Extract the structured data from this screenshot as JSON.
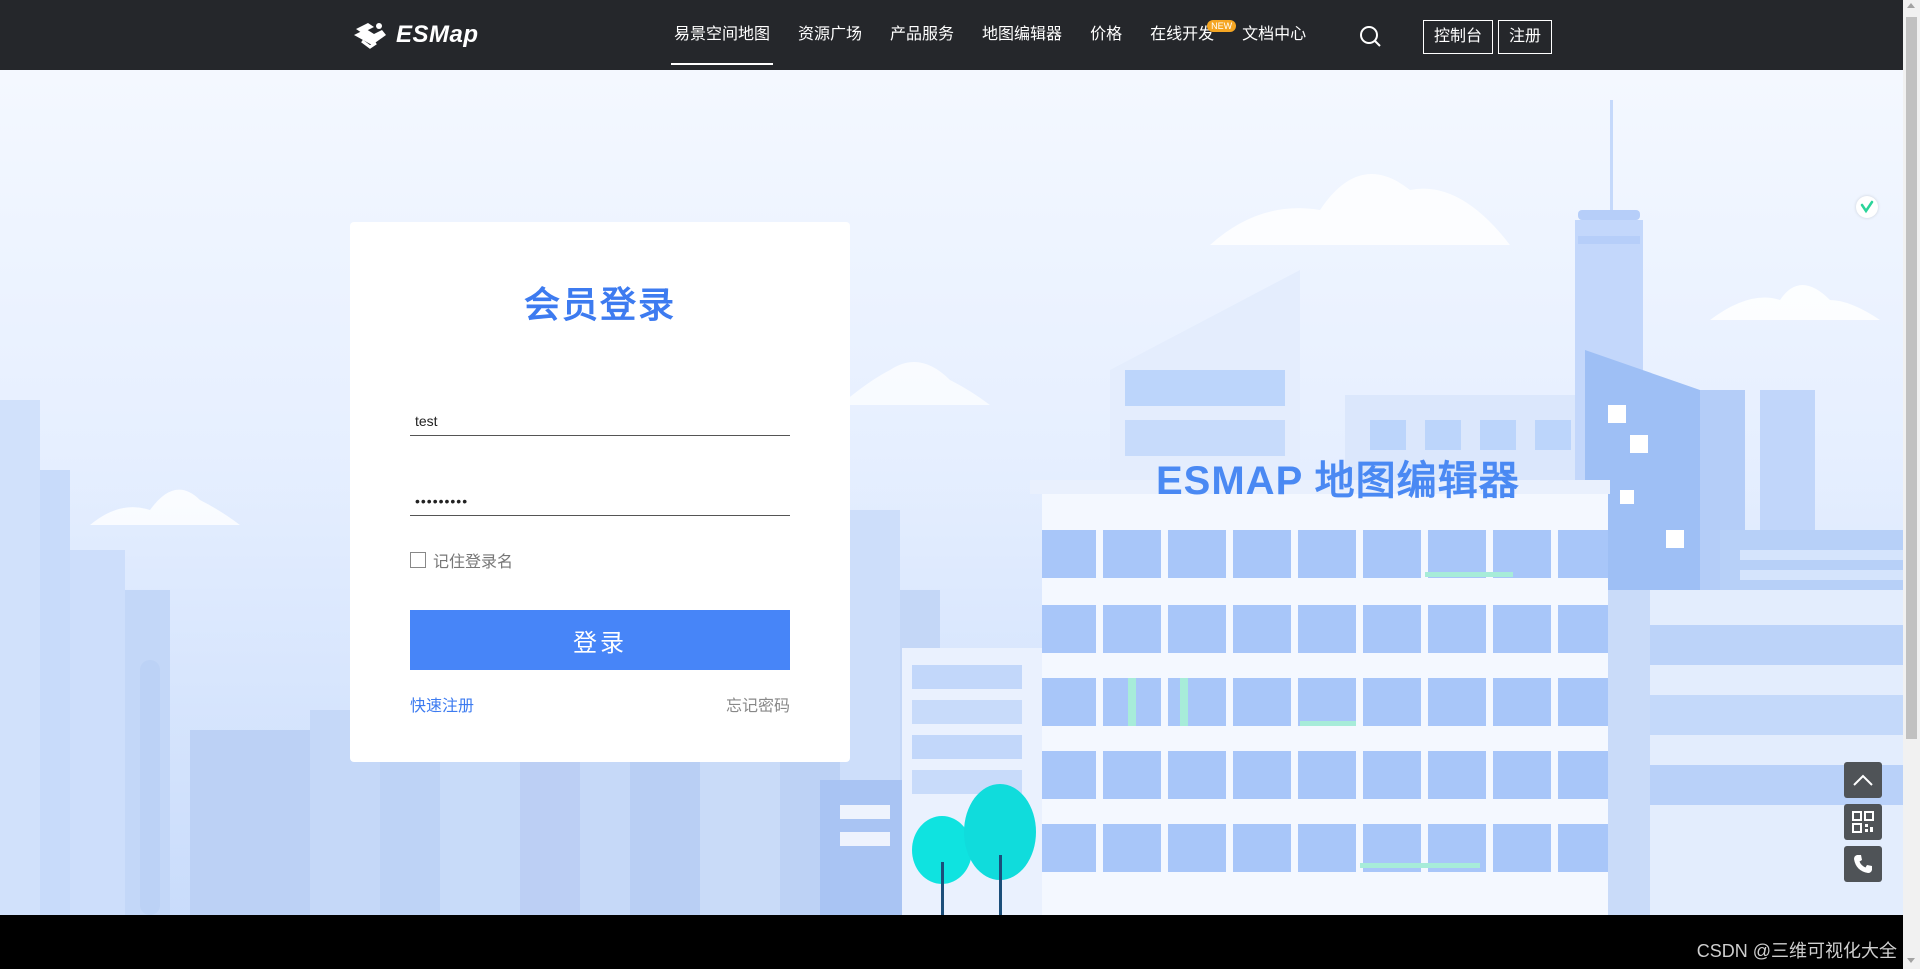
{
  "brand": {
    "name": "ESMap"
  },
  "nav": {
    "items": [
      {
        "label": "易景空间地图",
        "active": true
      },
      {
        "label": "资源广场"
      },
      {
        "label": "产品服务"
      },
      {
        "label": "地图编辑器"
      },
      {
        "label": "价格"
      },
      {
        "label": "在线开发",
        "badge": "NEW"
      },
      {
        "label": "文档中心"
      }
    ],
    "console_label": "控制台",
    "register_label": "注册"
  },
  "hero": {
    "title": "ESMAP 地图编辑器"
  },
  "login": {
    "title": "会员登录",
    "username_value": "test",
    "password_value": "•••••••••",
    "remember_label": "记住登录名",
    "remember_checked": false,
    "submit_label": "登录",
    "register_link": "快速注册",
    "forgot_link": "忘记密码"
  },
  "side_widgets": [
    "back-to-top-icon",
    "qr-code-icon",
    "phone-icon"
  ],
  "watermark": "CSDN @三维可视化大全",
  "colors": {
    "navbar": "#25272b",
    "accent": "#4785f8",
    "title_blue": "#3d7bf0",
    "hero_bg": "#e6efff"
  }
}
